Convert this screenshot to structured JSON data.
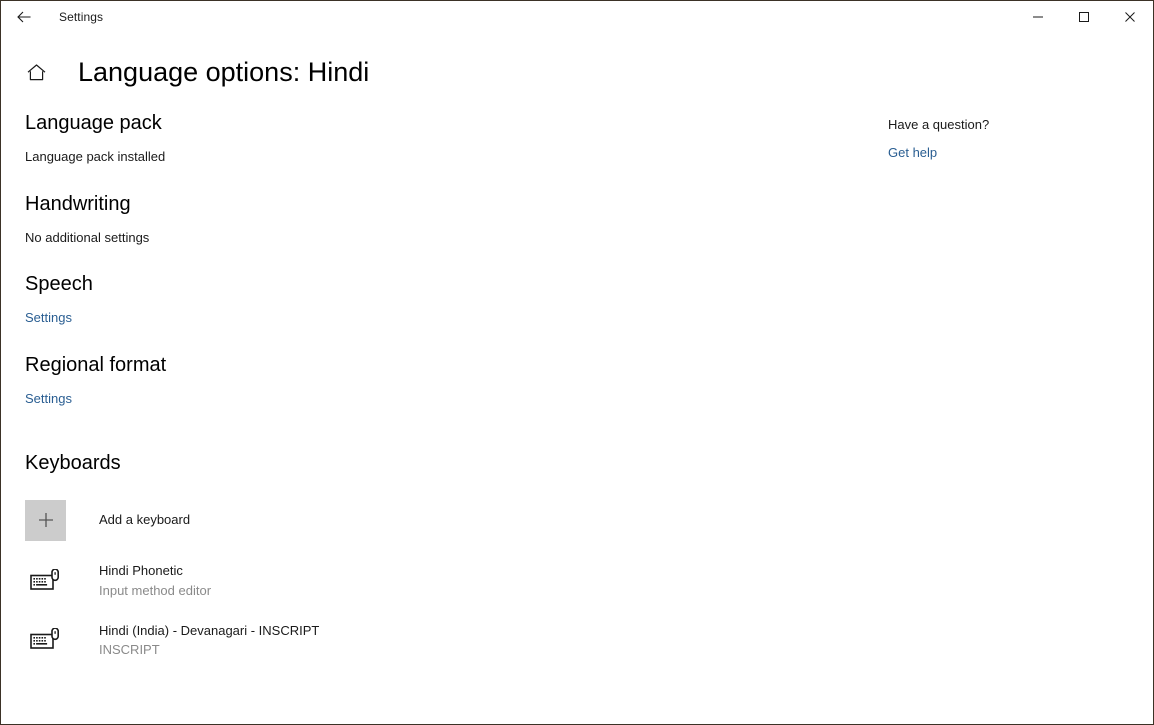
{
  "window": {
    "app_title": "Settings",
    "back_icon": "back-arrow-icon",
    "minimize_icon": "minimize-icon",
    "maximize_icon": "maximize-icon",
    "close_icon": "close-icon",
    "border_color": "#3b3226"
  },
  "header": {
    "home_icon": "home-icon",
    "title": "Language options: Hindi"
  },
  "sections": {
    "language_pack": {
      "heading": "Language pack",
      "status": "Language pack installed"
    },
    "handwriting": {
      "heading": "Handwriting",
      "status": "No additional settings"
    },
    "speech": {
      "heading": "Speech",
      "link": "Settings"
    },
    "regional_format": {
      "heading": "Regional format",
      "link": "Settings"
    },
    "keyboards": {
      "heading": "Keyboards",
      "add_label": "Add a keyboard",
      "add_icon": "plus-icon",
      "items": [
        {
          "icon": "keyboard-ime-icon",
          "name": "Hindi Phonetic",
          "subtitle": "Input method editor"
        },
        {
          "icon": "keyboard-ime-icon",
          "name": "Hindi (India) - Devanagari - INSCRIPT",
          "subtitle": "INSCRIPT"
        }
      ]
    }
  },
  "help_panel": {
    "title": "Have a question?",
    "link": "Get help"
  },
  "colors": {
    "link": "#2a5e92",
    "text": "#1a1a1a",
    "subtle_text": "#8a8a8a",
    "tile": "#cccccc"
  }
}
